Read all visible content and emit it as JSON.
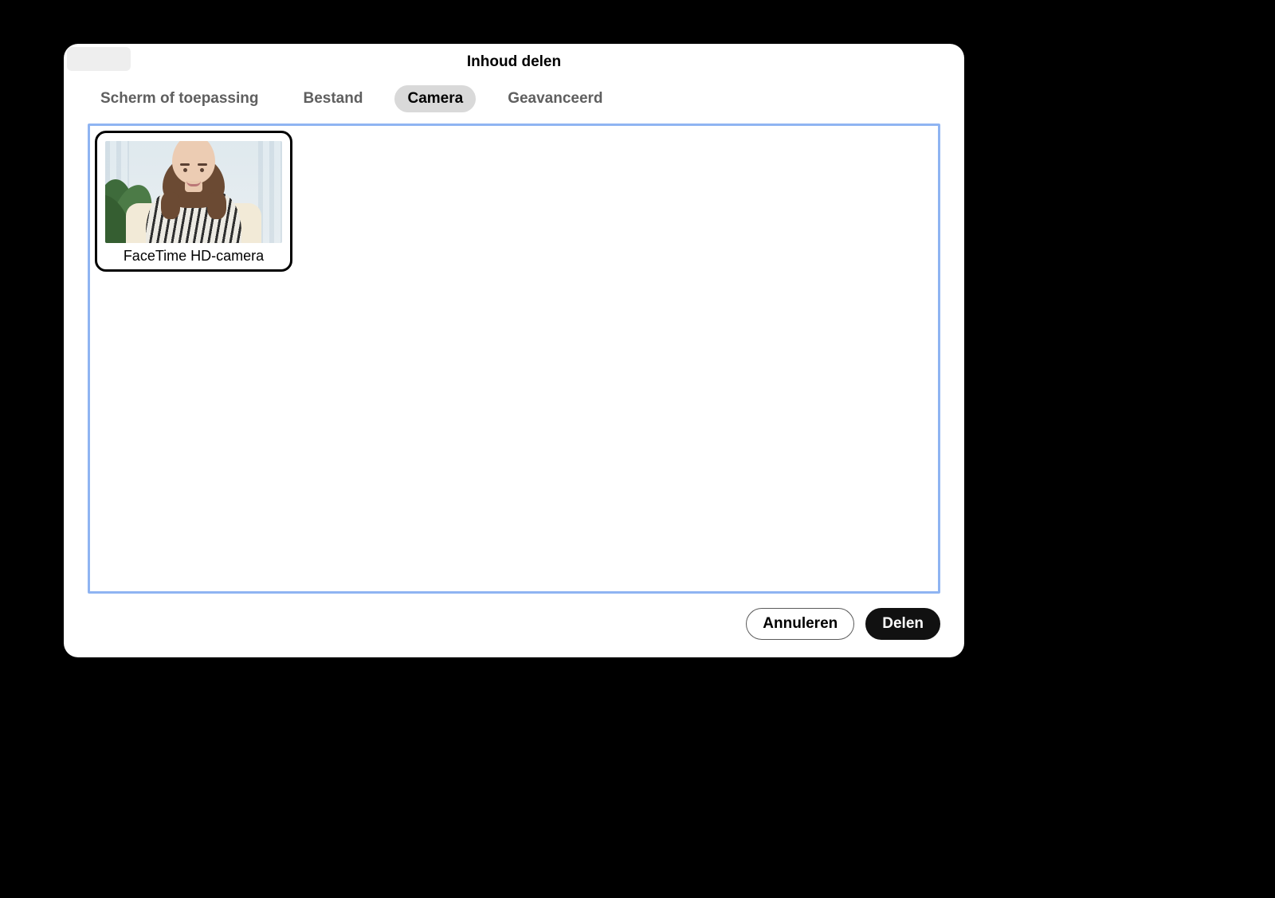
{
  "dialog": {
    "title": "Inhoud delen"
  },
  "tabs": {
    "screen_app": "Scherm of toepassing",
    "file": "Bestand",
    "camera": "Camera",
    "advanced": "Geavanceerd",
    "active": "camera"
  },
  "cameras": [
    {
      "label": "FaceTime HD-camera"
    }
  ],
  "footer": {
    "cancel": "Annuleren",
    "share": "Delen"
  }
}
